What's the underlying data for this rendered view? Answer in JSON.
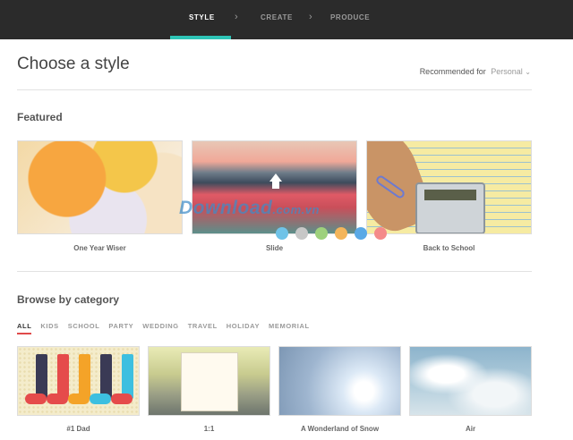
{
  "steps": [
    {
      "label": "STYLE",
      "active": true
    },
    {
      "label": "CREATE",
      "active": false
    },
    {
      "label": "PRODUCE",
      "active": false
    }
  ],
  "page": {
    "title": "Choose a style",
    "recommended_label": "Recommended for",
    "recommended_value": "Personal"
  },
  "featured": {
    "title": "Featured",
    "items": [
      {
        "label": "One Year Wiser"
      },
      {
        "label": "Slide"
      },
      {
        "label": "Back to School"
      }
    ]
  },
  "carousel_dot_colors": [
    "#6fc3e8",
    "#c7c7c7",
    "#9ed17c",
    "#f4b55a",
    "#5aa9e6",
    "#f48a8a"
  ],
  "watermark": {
    "brand": "Download",
    "tld": ".com.vn"
  },
  "browse": {
    "title": "Browse by category",
    "categories": [
      "ALL",
      "KIDS",
      "SCHOOL",
      "PARTY",
      "WEDDING",
      "TRAVEL",
      "HOLIDAY",
      "MEMORIAL"
    ],
    "active_category": "ALL",
    "tiles": [
      {
        "label": "#1 Dad"
      },
      {
        "label": "1:1"
      },
      {
        "label": "A Wonderland of Snow"
      },
      {
        "label": "Air"
      }
    ]
  },
  "colors": {
    "accent": "#2ec4b6",
    "nav_bg": "#2b2b2b",
    "active_category_underline": "#e04a4a"
  }
}
